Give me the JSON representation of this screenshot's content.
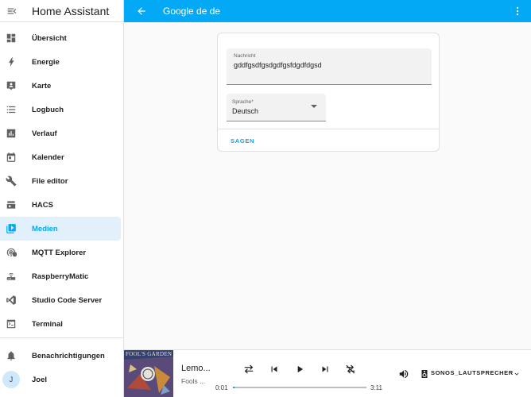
{
  "sidebar": {
    "title": "Home Assistant",
    "items": [
      {
        "label": "Übersicht",
        "icon": "dashboard-icon"
      },
      {
        "label": "Energie",
        "icon": "lightning-icon"
      },
      {
        "label": "Karte",
        "icon": "map-icon"
      },
      {
        "label": "Logbuch",
        "icon": "list-icon"
      },
      {
        "label": "Verlauf",
        "icon": "chart-icon"
      },
      {
        "label": "Kalender",
        "icon": "calendar-icon"
      },
      {
        "label": "File editor",
        "icon": "wrench-icon"
      },
      {
        "label": "HACS",
        "icon": "hacs-icon"
      },
      {
        "label": "Medien",
        "icon": "media-icon",
        "active": true
      },
      {
        "label": "MQTT Explorer",
        "icon": "antenna-icon"
      },
      {
        "label": "RaspberryMatic",
        "icon": "router-icon"
      },
      {
        "label": "Studio Code Server",
        "icon": "vscode-icon"
      },
      {
        "label": "Terminal",
        "icon": "terminal-icon"
      }
    ],
    "notifications_label": "Benachrichtigungen",
    "user": {
      "initial": "J",
      "name": "Joel"
    }
  },
  "topbar": {
    "title": "Google de de"
  },
  "form": {
    "message_label": "Nachricht",
    "message_value": "gddfgsdfgsdgdfgsfdgdfdgsd",
    "language_label": "Sprache*",
    "language_value": "Deutsch",
    "action_label": "SAGEN"
  },
  "player": {
    "album_art_text": "FOOL'S GARDEN",
    "title": "Lemo...",
    "artist": "Fools ...",
    "elapsed": "0:01",
    "duration": "3:11",
    "progress": 0.005,
    "speaker": "SONOS_LAUTSPRECHER"
  },
  "colors": {
    "accent": "#03a9f4",
    "active_bg": "#e1f0fb"
  }
}
